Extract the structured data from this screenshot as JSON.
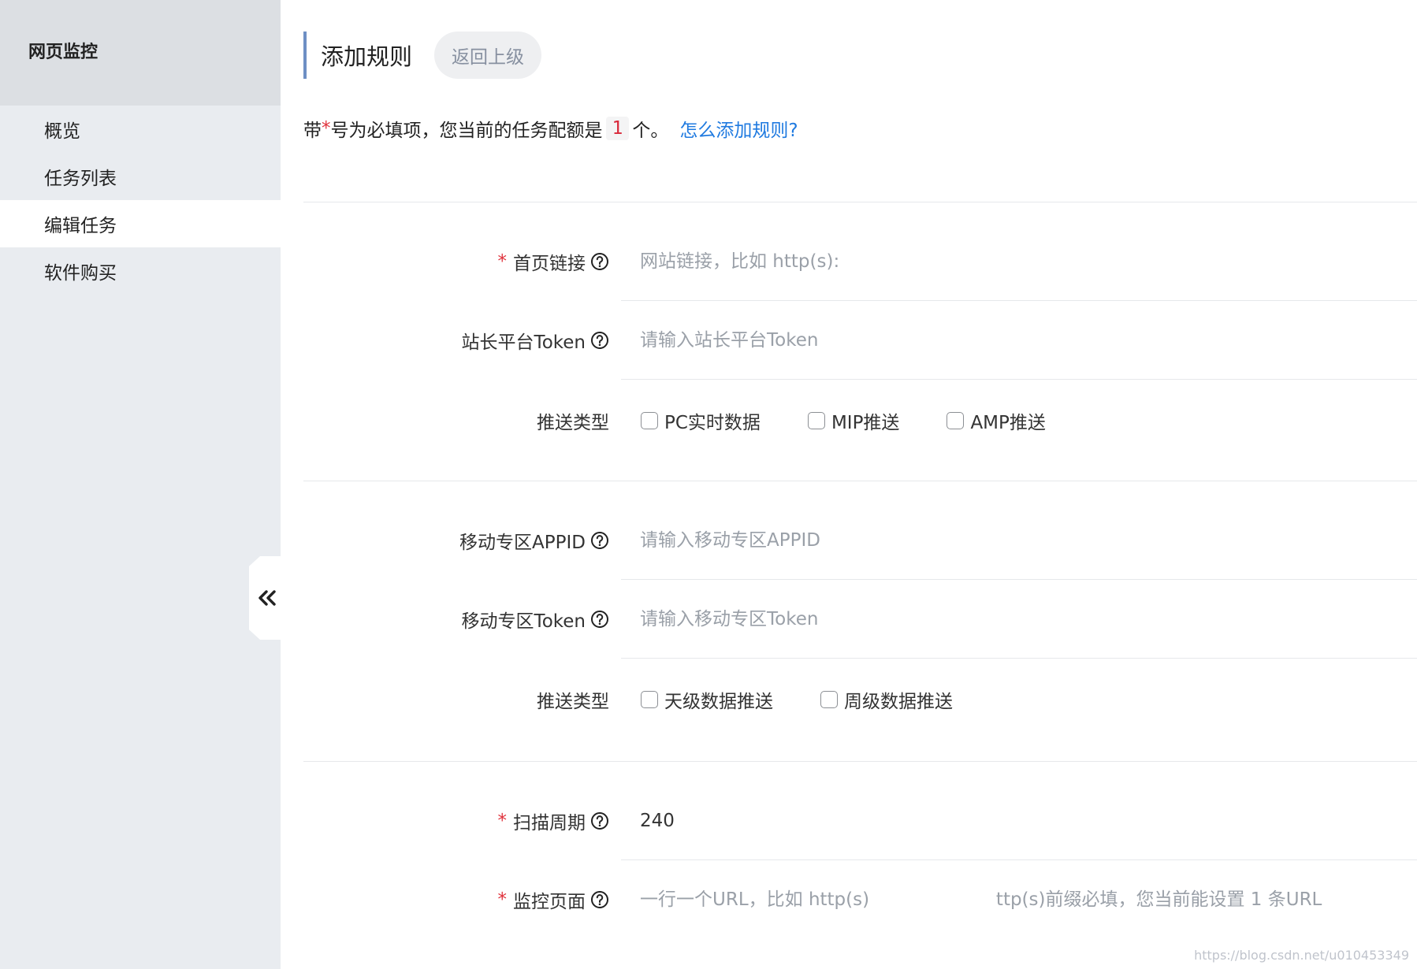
{
  "sidebar": {
    "title": "网页监控",
    "items": [
      {
        "label": "概览",
        "active": false
      },
      {
        "label": "任务列表",
        "active": false
      },
      {
        "label": "编辑任务",
        "active": true
      },
      {
        "label": "软件购买",
        "active": false
      }
    ],
    "collapse_icon": "double-chevron-left-icon"
  },
  "header": {
    "title": "添加规则",
    "back_label": "返回上级"
  },
  "notice": {
    "prefix": "带",
    "star": "*",
    "text": "号为必填项，您当前的任务配额是",
    "quota": "1",
    "suffix": "个。",
    "link": "怎么添加规则?"
  },
  "form": {
    "homepage": {
      "label": "首页链接",
      "required": true,
      "placeholder": "网站链接，比如 http(s):"
    },
    "site_token": {
      "label": "站长平台Token",
      "required": false,
      "placeholder": "请输入站长平台Token"
    },
    "push_type_1": {
      "label": "推送类型",
      "options": [
        "PC实时数据",
        "MIP推送",
        "AMP推送"
      ]
    },
    "mobile_appid": {
      "label": "移动专区APPID",
      "required": false,
      "placeholder": "请输入移动专区APPID"
    },
    "mobile_token": {
      "label": "移动专区Token",
      "required": false,
      "placeholder": "请输入移动专区Token"
    },
    "push_type_2": {
      "label": "推送类型",
      "options": [
        "天级数据推送",
        "周级数据推送"
      ]
    },
    "scan_period": {
      "label": "扫描周期",
      "required": true,
      "value": "240"
    },
    "monitor_pages": {
      "label": "监控页面",
      "required": true,
      "placeholder": "一行一个URL，比如 http(s)                      ttp(s)前缀必填，您当前能设置 1 条URL"
    }
  },
  "watermark": "https://blog.csdn.net/u010453349"
}
